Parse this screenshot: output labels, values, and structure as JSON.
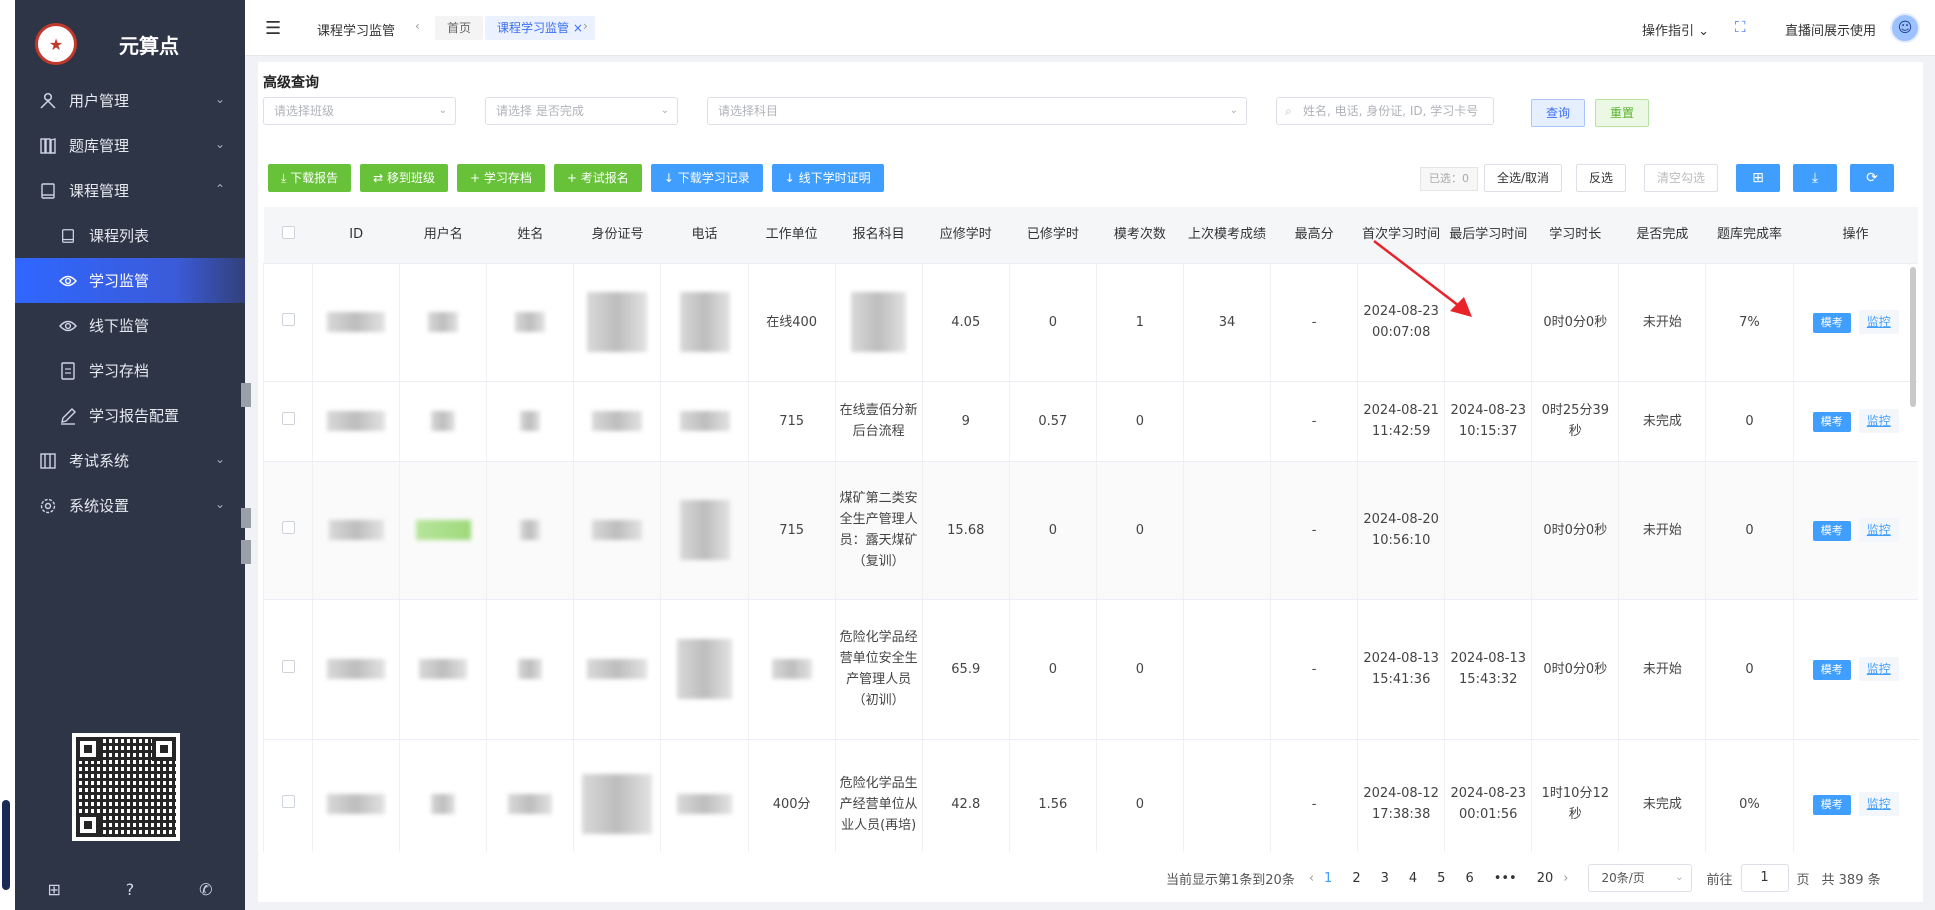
{
  "brand": {
    "name": "元算点",
    "logo_icon": "star-seal"
  },
  "header": {
    "page_name": "课程学习监管",
    "tabs": [
      {
        "label": "首页"
      },
      {
        "label": "课程学习监管"
      }
    ],
    "op_guide": "操作指引",
    "live_user": "直播间展示使用"
  },
  "sidebar": {
    "items": [
      {
        "label": "用户管理",
        "icon": "users-icon"
      },
      {
        "label": "题库管理",
        "icon": "books-icon"
      },
      {
        "label": "课程管理",
        "icon": "book-icon"
      },
      {
        "label": "课程列表",
        "icon": "book-icon"
      },
      {
        "label": "学习监管",
        "icon": "eye-icon"
      },
      {
        "label": "线下监管",
        "icon": "eye-icon"
      },
      {
        "label": "学习存档",
        "icon": "doc-icon"
      },
      {
        "label": "学习报告配置",
        "icon": "pen-icon"
      },
      {
        "label": "考试系统",
        "icon": "exam-icon"
      },
      {
        "label": "系统设置",
        "icon": "gear-icon"
      }
    ]
  },
  "filters": {
    "title": "高级查询",
    "class_placeholder": "请选择班级",
    "complete_placeholder": "请选择 是否完成",
    "subject_placeholder": "请选择科目",
    "search_placeholder": "姓名, 电话, 身份证, ID, 学习卡号",
    "query": "查询",
    "reset": "重置"
  },
  "toolbar": {
    "download_report": "下载报告",
    "move_class": "移到班级",
    "archive": "学习存档",
    "exam_signup": "考试报名",
    "download_records": "下载学习记录",
    "offline_cert": "线下学时证明",
    "selected": "已选：0",
    "select_all": "全选/取消",
    "invert": "反选",
    "clear": "清空勾选"
  },
  "table": {
    "headers": [
      "ID",
      "用户名",
      "姓名",
      "身份证号",
      "电话",
      "工作单位",
      "报名科目",
      "应修学时",
      "已修学时",
      "模考次数",
      "上次模考成绩",
      "最高分",
      "首次学习时间",
      "最后学习时间",
      "学习时长",
      "是否完成",
      "题库完成率",
      "操作"
    ],
    "rows": [
      {
        "unit": "在线400",
        "subject": "",
        "required": "4.05",
        "done": "0",
        "mock_count": "1",
        "last_score": "34",
        "max": "-",
        "first": "2024-08-23 00:07:08",
        "last": "",
        "duration": "0时0分0秒",
        "complete": "未开始",
        "rate": "7%"
      },
      {
        "unit": "715",
        "subject": "在线壹佰分新后台流程",
        "required": "9",
        "done": "0.57",
        "mock_count": "0",
        "last_score": "",
        "max": "-",
        "first": "2024-08-21 11:42:59",
        "last": "2024-08-23 10:15:37",
        "duration": "0时25分39秒",
        "complete": "未完成",
        "rate": "0"
      },
      {
        "unit": "715",
        "subject": "煤矿第二类安全生产管理人员：露天煤矿（复训）",
        "required": "15.68",
        "done": "0",
        "mock_count": "0",
        "last_score": "",
        "max": "-",
        "first": "2024-08-20 10:56:10",
        "last": "",
        "duration": "0时0分0秒",
        "complete": "未开始",
        "rate": "0"
      },
      {
        "unit": "",
        "subject": "危险化学品经营单位安全生产管理人员（初训）",
        "required": "65.9",
        "done": "0",
        "mock_count": "0",
        "last_score": "",
        "max": "-",
        "first": "2024-08-13 15:41:36",
        "last": "2024-08-13 15:43:32",
        "duration": "0时0分0秒",
        "complete": "未开始",
        "rate": "0"
      },
      {
        "unit": "400分",
        "subject": "危险化学品生产经营单位从业人员(再培)",
        "required": "42.8",
        "done": "1.56",
        "mock_count": "0",
        "last_score": "",
        "max": "-",
        "first": "2024-08-12 17:38:38",
        "last": "2024-08-23 00:01:56",
        "duration": "1时10分12秒",
        "complete": "未完成",
        "rate": "0%"
      }
    ],
    "op_exam": "模考",
    "op_monitor": "监控"
  },
  "pagination": {
    "summary": "当前显示第1条到20条",
    "pages": [
      "1",
      "2",
      "3",
      "4",
      "5",
      "6",
      "•••",
      "20"
    ],
    "page_size": "20条/页",
    "goto_label": "前往",
    "goto_value": "1",
    "page_unit": "页",
    "total": "共 389 条"
  }
}
